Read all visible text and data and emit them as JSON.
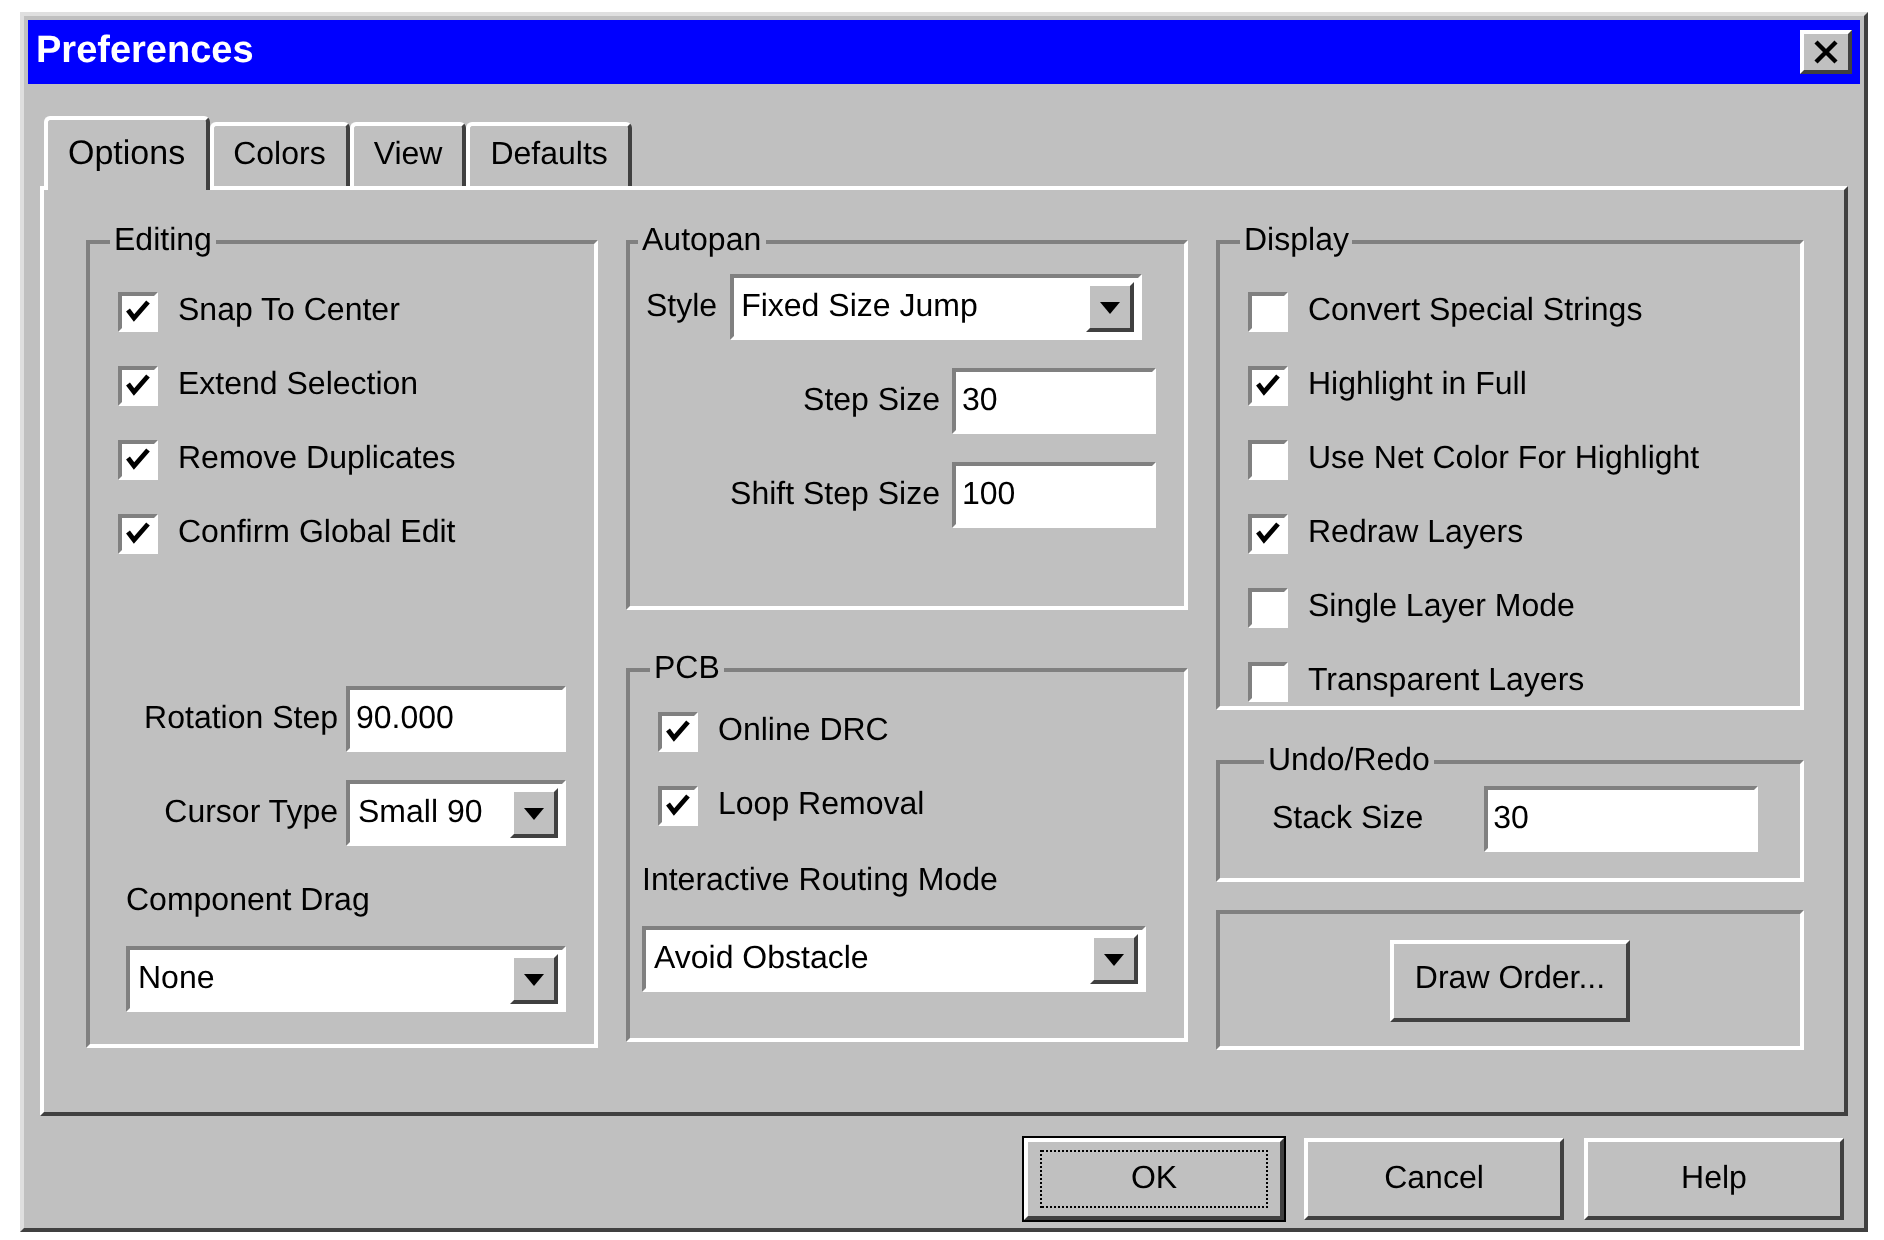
{
  "window": {
    "title": "Preferences"
  },
  "tabs": [
    {
      "label": "Options",
      "selected": true
    },
    {
      "label": "Colors",
      "selected": false
    },
    {
      "label": "View",
      "selected": false
    },
    {
      "label": "Defaults",
      "selected": false
    }
  ],
  "editing": {
    "title": "Editing",
    "checkboxes": [
      {
        "label": "Snap To Center",
        "checked": true
      },
      {
        "label": "Extend Selection",
        "checked": true
      },
      {
        "label": "Remove Duplicates",
        "checked": true
      },
      {
        "label": "Confirm Global Edit",
        "checked": true
      }
    ],
    "rotation_step": {
      "label": "Rotation Step",
      "value": "90.000"
    },
    "cursor_type": {
      "label": "Cursor Type",
      "value": "Small 90"
    },
    "component_drag": {
      "label": "Component Drag",
      "value": "None"
    }
  },
  "autopan": {
    "title": "Autopan",
    "style": {
      "label": "Style",
      "value": "Fixed Size Jump"
    },
    "step_size": {
      "label": "Step Size",
      "value": "30"
    },
    "shift_step_size": {
      "label": "Shift Step Size",
      "value": "100"
    }
  },
  "pcb": {
    "title": "PCB",
    "checkboxes": [
      {
        "label": "Online DRC",
        "checked": true
      },
      {
        "label": "Loop Removal",
        "checked": true
      }
    ],
    "routing_mode": {
      "label": "Interactive Routing Mode",
      "value": "Avoid Obstacle"
    }
  },
  "display": {
    "title": "Display",
    "checkboxes": [
      {
        "label": "Convert Special Strings",
        "checked": false
      },
      {
        "label": "Highlight in Full",
        "checked": true
      },
      {
        "label": "Use Net Color For Highlight",
        "checked": false
      },
      {
        "label": "Redraw Layers",
        "checked": true
      },
      {
        "label": "Single Layer Mode",
        "checked": false
      },
      {
        "label": "Transparent Layers",
        "checked": false
      }
    ]
  },
  "undo_redo": {
    "title": "Undo/Redo",
    "stack_size": {
      "label": "Stack Size",
      "value": "30"
    }
  },
  "draw_order_button": "Draw Order...",
  "buttons": [
    {
      "label": "OK",
      "default": true
    },
    {
      "label": "Cancel",
      "default": false
    },
    {
      "label": "Help",
      "default": false
    }
  ]
}
